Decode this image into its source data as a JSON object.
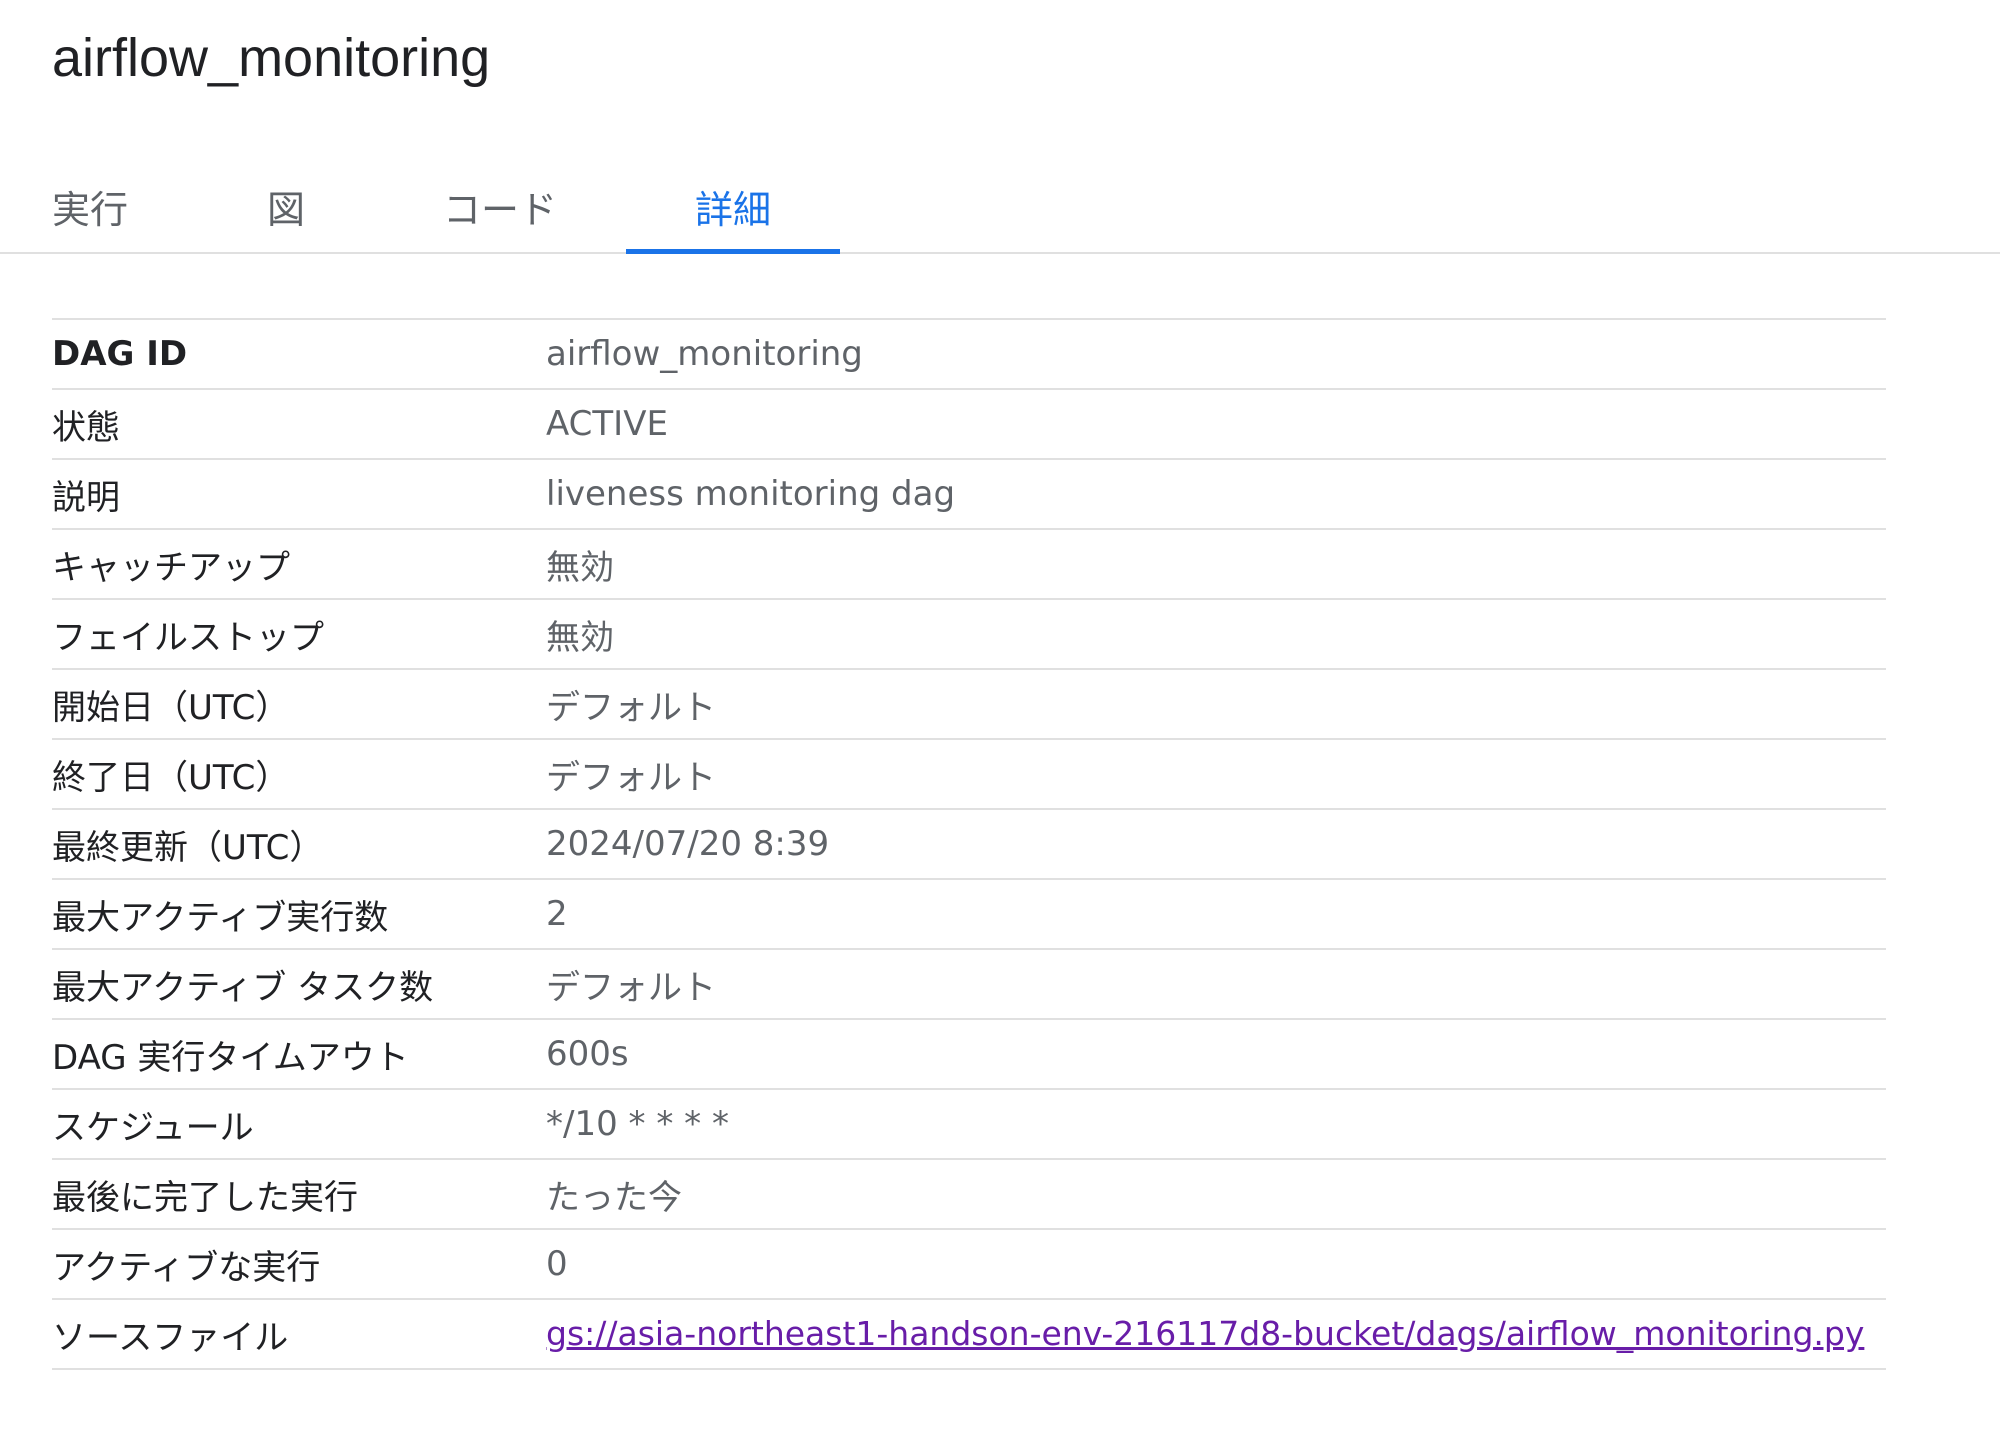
{
  "header": {
    "title": "airflow_monitoring"
  },
  "tabs": [
    {
      "label": "実行",
      "active": false
    },
    {
      "label": "図",
      "active": false
    },
    {
      "label": "コード",
      "active": false
    },
    {
      "label": "詳細",
      "active": true
    }
  ],
  "details": {
    "rows": [
      {
        "label": "DAG ID",
        "value": "airflow_monitoring"
      },
      {
        "label": "状態",
        "value": "ACTIVE"
      },
      {
        "label": "説明",
        "value": "liveness monitoring dag"
      },
      {
        "label": "キャッチアップ",
        "value": "無効"
      },
      {
        "label": "フェイルストップ",
        "value": "無効"
      },
      {
        "label": "開始日（UTC）",
        "value": "デフォルト"
      },
      {
        "label": "終了日（UTC）",
        "value": "デフォルト"
      },
      {
        "label": "最終更新（UTC）",
        "value": "2024/07/20 8:39"
      },
      {
        "label": "最大アクティブ実行数",
        "value": "2"
      },
      {
        "label": "最大アクティブ タスク数",
        "value": "デフォルト"
      },
      {
        "label": "DAG 実行タイムアウト",
        "value": "600s"
      },
      {
        "label": "スケジュール",
        "value": "*/10 * * * *"
      },
      {
        "label": "最後に完了した実行",
        "value": "たった今"
      },
      {
        "label": "アクティブな実行",
        "value": "0"
      },
      {
        "label": "ソースファイル",
        "value": "gs://asia-northeast1-handson-env-216117d8-bucket/dags/airflow_monitoring.py"
      }
    ]
  },
  "colors": {
    "accent": "#1a73e8",
    "link": "#681da8",
    "divider": "#e0e0e0",
    "label_text": "#202124",
    "value_text": "#5f6368"
  }
}
